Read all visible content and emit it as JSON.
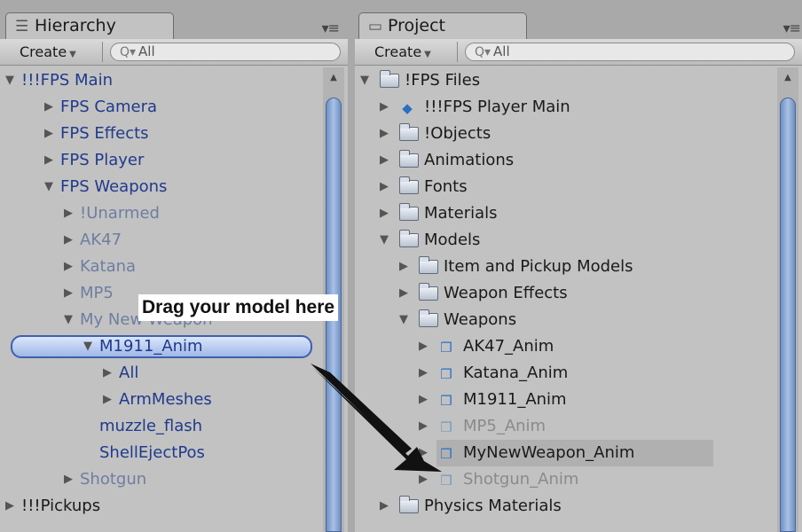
{
  "hierarchy": {
    "tab_label": "Hierarchy",
    "tab_icon": "list-icon",
    "create_label": "Create",
    "search_placeholder": "All",
    "items": [
      {
        "label": "!!!FPS Main",
        "state": "expanded",
        "style": "blue"
      },
      {
        "label": "FPS Camera",
        "state": "collapsed",
        "style": "blue"
      },
      {
        "label": "FPS Effects",
        "state": "collapsed",
        "style": "blue"
      },
      {
        "label": "FPS Player",
        "state": "collapsed",
        "style": "blue"
      },
      {
        "label": "FPS Weapons",
        "state": "expanded",
        "style": "blue"
      },
      {
        "label": "!Unarmed",
        "state": "collapsed",
        "style": "gray"
      },
      {
        "label": "AK47",
        "state": "collapsed",
        "style": "gray"
      },
      {
        "label": "Katana",
        "state": "collapsed",
        "style": "gray"
      },
      {
        "label": "MP5",
        "state": "collapsed",
        "style": "gray"
      },
      {
        "label": "My New Weapon",
        "state": "expanded",
        "style": "gray"
      },
      {
        "label": "M1911_Anim",
        "state": "expanded",
        "style": "blue",
        "selected": true
      },
      {
        "label": "All",
        "state": "collapsed",
        "style": "blue"
      },
      {
        "label": "ArmMeshes",
        "state": "collapsed",
        "style": "blue"
      },
      {
        "label": "muzzle_flash",
        "state": "none",
        "style": "blue"
      },
      {
        "label": "ShellEjectPos",
        "state": "none",
        "style": "blue"
      },
      {
        "label": "Shotgun",
        "state": "collapsed",
        "style": "gray"
      },
      {
        "label": "!!!Pickups",
        "state": "collapsed",
        "style": "black"
      }
    ]
  },
  "project": {
    "tab_label": "Project",
    "tab_icon": "folder-icon",
    "create_label": "Create",
    "search_placeholder": "All",
    "items": [
      {
        "label": "!FPS Files",
        "state": "expanded",
        "icon": "folder"
      },
      {
        "label": "!!!FPS Player Main",
        "state": "collapsed",
        "icon": "prefab"
      },
      {
        "label": "!Objects",
        "state": "collapsed",
        "icon": "folder"
      },
      {
        "label": "Animations",
        "state": "collapsed",
        "icon": "folder"
      },
      {
        "label": "Fonts",
        "state": "collapsed",
        "icon": "folder"
      },
      {
        "label": "Materials",
        "state": "collapsed",
        "icon": "folder"
      },
      {
        "label": "Models",
        "state": "expanded",
        "icon": "folder"
      },
      {
        "label": "Item and Pickup Models",
        "state": "collapsed",
        "icon": "folder"
      },
      {
        "label": "Weapon Effects",
        "state": "collapsed",
        "icon": "folder"
      },
      {
        "label": "Weapons",
        "state": "expanded",
        "icon": "folder"
      },
      {
        "label": "AK47_Anim",
        "state": "collapsed",
        "icon": "model"
      },
      {
        "label": "Katana_Anim",
        "state": "collapsed",
        "icon": "model"
      },
      {
        "label": "M1911_Anim",
        "state": "collapsed",
        "icon": "model"
      },
      {
        "label": "MP5_Anim",
        "state": "collapsed",
        "icon": "model",
        "faded": true
      },
      {
        "label": "MyNewWeapon_Anim",
        "state": "collapsed",
        "icon": "model",
        "highlighted": true
      },
      {
        "label": "Shotgun_Anim",
        "state": "collapsed",
        "icon": "model",
        "faded": true
      },
      {
        "label": "Physics Materials",
        "state": "collapsed",
        "icon": "folder"
      }
    ]
  },
  "callout": {
    "text": "Drag your model here"
  },
  "colors": {
    "panel_bg": "#c2c2c2",
    "selection_border": "#3e5fb0",
    "tree_text_blue": "#203a8c",
    "tree_text_gray": "#6e7ea0"
  }
}
